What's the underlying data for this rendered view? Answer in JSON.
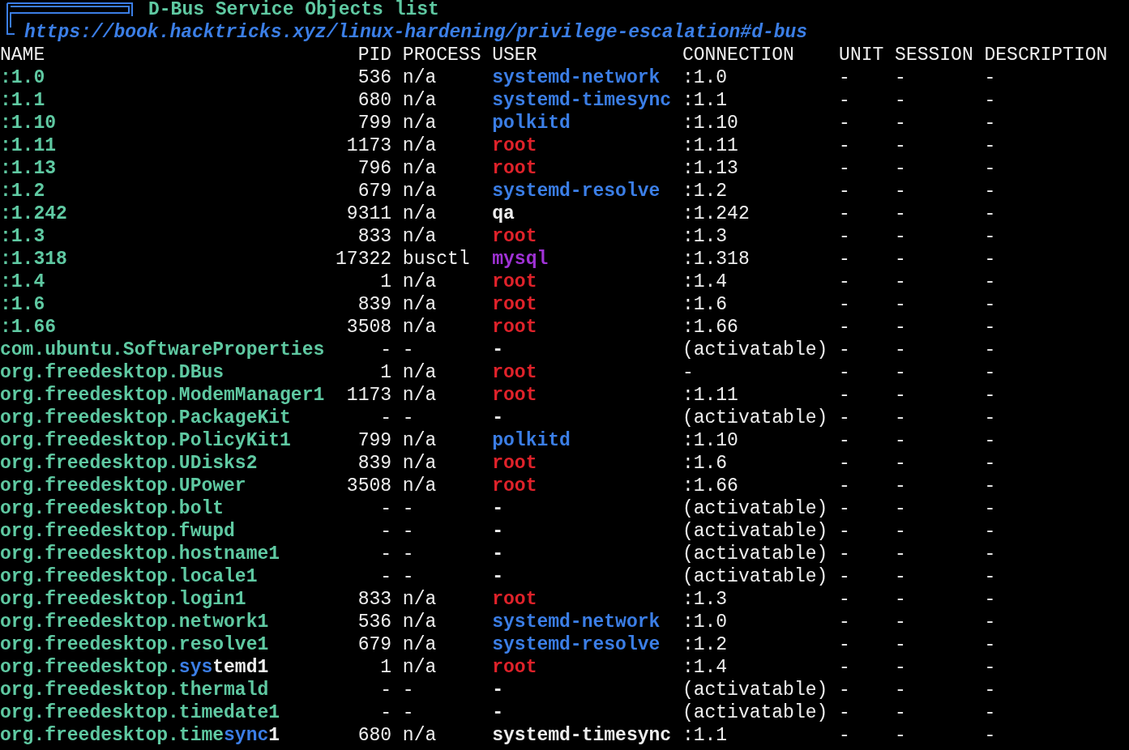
{
  "title": "D-Bus Service Objects list",
  "url": "https://book.hacktricks.xyz/linux-hardening/privilege-escalation#d-bus",
  "columns": [
    "NAME",
    "PID",
    "PROCESS",
    "USER",
    "CONNECTION",
    "UNIT",
    "SESSION",
    "DESCRIPTION"
  ],
  "rows": [
    {
      "name": [
        {
          "text": ":1.0",
          "color": "#5fc9a2"
        }
      ],
      "pid": "536",
      "process": "n/a",
      "user": {
        "text": "systemd-network",
        "color": "#3b7ee6"
      },
      "connection": ":1.0",
      "unit": "-",
      "session": "-",
      "description": "-"
    },
    {
      "name": [
        {
          "text": ":1.1",
          "color": "#5fc9a2"
        }
      ],
      "pid": "680",
      "process": "n/a",
      "user": {
        "text": "systemd-timesync",
        "color": "#3b7ee6"
      },
      "connection": ":1.1",
      "unit": "-",
      "session": "-",
      "description": "-"
    },
    {
      "name": [
        {
          "text": ":1.10",
          "color": "#5fc9a2"
        }
      ],
      "pid": "799",
      "process": "n/a",
      "user": {
        "text": "polkitd",
        "color": "#3b7ee6"
      },
      "connection": ":1.10",
      "unit": "-",
      "session": "-",
      "description": "-"
    },
    {
      "name": [
        {
          "text": ":1.11",
          "color": "#5fc9a2"
        }
      ],
      "pid": "1173",
      "process": "n/a",
      "user": {
        "text": "root",
        "color": "#e0222a"
      },
      "connection": ":1.11",
      "unit": "-",
      "session": "-",
      "description": "-"
    },
    {
      "name": [
        {
          "text": ":1.13",
          "color": "#5fc9a2"
        }
      ],
      "pid": "796",
      "process": "n/a",
      "user": {
        "text": "root",
        "color": "#e0222a"
      },
      "connection": ":1.13",
      "unit": "-",
      "session": "-",
      "description": "-"
    },
    {
      "name": [
        {
          "text": ":1.2",
          "color": "#5fc9a2"
        }
      ],
      "pid": "679",
      "process": "n/a",
      "user": {
        "text": "systemd-resolve",
        "color": "#3b7ee6"
      },
      "connection": ":1.2",
      "unit": "-",
      "session": "-",
      "description": "-"
    },
    {
      "name": [
        {
          "text": ":1.242",
          "color": "#5fc9a2"
        }
      ],
      "pid": "9311",
      "process": "n/a",
      "user": {
        "text": "qa",
        "color": "#eeeeee"
      },
      "connection": ":1.242",
      "unit": "-",
      "session": "-",
      "description": "-"
    },
    {
      "name": [
        {
          "text": ":1.3",
          "color": "#5fc9a2"
        }
      ],
      "pid": "833",
      "process": "n/a",
      "user": {
        "text": "root",
        "color": "#e0222a"
      },
      "connection": ":1.3",
      "unit": "-",
      "session": "-",
      "description": "-"
    },
    {
      "name": [
        {
          "text": ":1.318",
          "color": "#5fc9a2"
        }
      ],
      "pid": "17322",
      "process": "busctl",
      "user": {
        "text": "mysql",
        "color": "#a032d6"
      },
      "connection": ":1.318",
      "unit": "-",
      "session": "-",
      "description": "-"
    },
    {
      "name": [
        {
          "text": ":1.4",
          "color": "#5fc9a2"
        }
      ],
      "pid": "1",
      "process": "n/a",
      "user": {
        "text": "root",
        "color": "#e0222a"
      },
      "connection": ":1.4",
      "unit": "-",
      "session": "-",
      "description": "-"
    },
    {
      "name": [
        {
          "text": ":1.6",
          "color": "#5fc9a2"
        }
      ],
      "pid": "839",
      "process": "n/a",
      "user": {
        "text": "root",
        "color": "#e0222a"
      },
      "connection": ":1.6",
      "unit": "-",
      "session": "-",
      "description": "-"
    },
    {
      "name": [
        {
          "text": ":1.66",
          "color": "#5fc9a2"
        }
      ],
      "pid": "3508",
      "process": "n/a",
      "user": {
        "text": "root",
        "color": "#e0222a"
      },
      "connection": ":1.66",
      "unit": "-",
      "session": "-",
      "description": "-"
    },
    {
      "name": [
        {
          "text": "com.ubuntu.SoftwareProperties",
          "color": "#5fc9a2"
        }
      ],
      "pid": "-",
      "process": "-",
      "user": {
        "text": "-",
        "color": "#eeeeee"
      },
      "connection": "(activatable)",
      "unit": "-",
      "session": "-",
      "description": "-"
    },
    {
      "name": [
        {
          "text": "org.freedesktop.DBus",
          "color": "#5fc9a2"
        }
      ],
      "pid": "1",
      "process": "n/a",
      "user": {
        "text": "root",
        "color": "#e0222a"
      },
      "connection": "-",
      "unit": "-",
      "session": "-",
      "description": "-"
    },
    {
      "name": [
        {
          "text": "org.freedesktop.ModemManager1",
          "color": "#5fc9a2"
        }
      ],
      "pid": "1173",
      "process": "n/a",
      "user": {
        "text": "root",
        "color": "#e0222a"
      },
      "connection": ":1.11",
      "unit": "-",
      "session": "-",
      "description": "-"
    },
    {
      "name": [
        {
          "text": "org.freedesktop.PackageKit",
          "color": "#5fc9a2"
        }
      ],
      "pid": "-",
      "process": "-",
      "user": {
        "text": "-",
        "color": "#eeeeee"
      },
      "connection": "(activatable)",
      "unit": "-",
      "session": "-",
      "description": "-"
    },
    {
      "name": [
        {
          "text": "org.freedesktop.PolicyKit1",
          "color": "#5fc9a2"
        }
      ],
      "pid": "799",
      "process": "n/a",
      "user": {
        "text": "polkitd",
        "color": "#3b7ee6"
      },
      "connection": ":1.10",
      "unit": "-",
      "session": "-",
      "description": "-"
    },
    {
      "name": [
        {
          "text": "org.freedesktop.UDisks2",
          "color": "#5fc9a2"
        }
      ],
      "pid": "839",
      "process": "n/a",
      "user": {
        "text": "root",
        "color": "#e0222a"
      },
      "connection": ":1.6",
      "unit": "-",
      "session": "-",
      "description": "-"
    },
    {
      "name": [
        {
          "text": "org.freedesktop.UPower",
          "color": "#5fc9a2"
        }
      ],
      "pid": "3508",
      "process": "n/a",
      "user": {
        "text": "root",
        "color": "#e0222a"
      },
      "connection": ":1.66",
      "unit": "-",
      "session": "-",
      "description": "-"
    },
    {
      "name": [
        {
          "text": "org.freedesktop.bolt",
          "color": "#5fc9a2"
        }
      ],
      "pid": "-",
      "process": "-",
      "user": {
        "text": "-",
        "color": "#eeeeee"
      },
      "connection": "(activatable)",
      "unit": "-",
      "session": "-",
      "description": "-"
    },
    {
      "name": [
        {
          "text": "org.freedesktop.fwupd",
          "color": "#5fc9a2"
        }
      ],
      "pid": "-",
      "process": "-",
      "user": {
        "text": "-",
        "color": "#eeeeee"
      },
      "connection": "(activatable)",
      "unit": "-",
      "session": "-",
      "description": "-"
    },
    {
      "name": [
        {
          "text": "org.freedesktop.hostname1",
          "color": "#5fc9a2"
        }
      ],
      "pid": "-",
      "process": "-",
      "user": {
        "text": "-",
        "color": "#eeeeee"
      },
      "connection": "(activatable)",
      "unit": "-",
      "session": "-",
      "description": "-"
    },
    {
      "name": [
        {
          "text": "org.freedesktop.locale1",
          "color": "#5fc9a2"
        }
      ],
      "pid": "-",
      "process": "-",
      "user": {
        "text": "-",
        "color": "#eeeeee"
      },
      "connection": "(activatable)",
      "unit": "-",
      "session": "-",
      "description": "-"
    },
    {
      "name": [
        {
          "text": "org.freedesktop.login1",
          "color": "#5fc9a2"
        }
      ],
      "pid": "833",
      "process": "n/a",
      "user": {
        "text": "root",
        "color": "#e0222a"
      },
      "connection": ":1.3",
      "unit": "-",
      "session": "-",
      "description": "-"
    },
    {
      "name": [
        {
          "text": "org.freedesktop.network1",
          "color": "#5fc9a2"
        }
      ],
      "pid": "536",
      "process": "n/a",
      "user": {
        "text": "systemd-network",
        "color": "#3b7ee6"
      },
      "connection": ":1.0",
      "unit": "-",
      "session": "-",
      "description": "-"
    },
    {
      "name": [
        {
          "text": "org.freedesktop.resolve1",
          "color": "#5fc9a2"
        }
      ],
      "pid": "679",
      "process": "n/a",
      "user": {
        "text": "systemd-resolve",
        "color": "#3b7ee6"
      },
      "connection": ":1.2",
      "unit": "-",
      "session": "-",
      "description": "-"
    },
    {
      "name": [
        {
          "text": "org.freedesktop.",
          "color": "#5fc9a2"
        },
        {
          "text": "sys",
          "color": "#3b7ee6"
        },
        {
          "text": "temd1",
          "color": "#eeeeee"
        }
      ],
      "pid": "1",
      "process": "n/a",
      "user": {
        "text": "root",
        "color": "#e0222a"
      },
      "connection": ":1.4",
      "unit": "-",
      "session": "-",
      "description": "-"
    },
    {
      "name": [
        {
          "text": "org.freedesktop.thermald",
          "color": "#5fc9a2"
        }
      ],
      "pid": "-",
      "process": "-",
      "user": {
        "text": "-",
        "color": "#eeeeee"
      },
      "connection": "(activatable)",
      "unit": "-",
      "session": "-",
      "description": "-"
    },
    {
      "name": [
        {
          "text": "org.freedesktop.timedate1",
          "color": "#5fc9a2"
        }
      ],
      "pid": "-",
      "process": "-",
      "user": {
        "text": "-",
        "color": "#eeeeee"
      },
      "connection": "(activatable)",
      "unit": "-",
      "session": "-",
      "description": "-"
    },
    {
      "name": [
        {
          "text": "org.freedesktop.time",
          "color": "#5fc9a2"
        },
        {
          "text": "sync",
          "color": "#3b7ee6"
        },
        {
          "text": "1",
          "color": "#eeeeee"
        }
      ],
      "pid": "680",
      "process": "n/a",
      "user": {
        "text": "systemd-timesync",
        "color": "#eeeeee"
      },
      "connection": ":1.1",
      "unit": "-",
      "session": "-",
      "description": "-"
    }
  ]
}
